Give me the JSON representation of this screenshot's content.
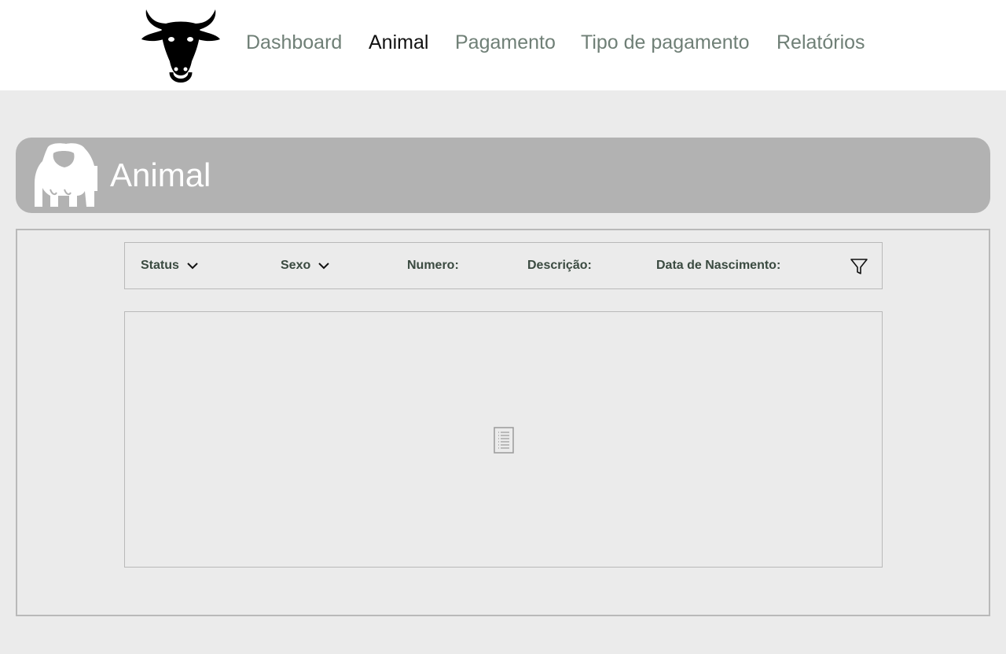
{
  "header": {
    "logo_icon": "bull-head-logo-icon",
    "nav": [
      {
        "label": "Dashboard",
        "active": false
      },
      {
        "label": "Animal",
        "active": true
      },
      {
        "label": "Pagamento",
        "active": false
      },
      {
        "label": "Tipo de pagamento",
        "active": false
      },
      {
        "label": "Relatórios",
        "active": false
      }
    ]
  },
  "banner": {
    "icon": "cow-icon",
    "title": "Animal"
  },
  "filters": {
    "status_label": "Status",
    "sexo_label": "Sexo",
    "numero_label": "Numero:",
    "descricao_label": "Descrição:",
    "nascimento_label": "Data de Nascimento:",
    "filter_icon": "funnel-icon"
  },
  "list": {
    "empty_icon": "document-list-icon"
  },
  "colors": {
    "background": "#ebebeb",
    "banner": "#b2b2b2",
    "nav_inactive": "#6f7f76",
    "nav_active": "#111111"
  }
}
